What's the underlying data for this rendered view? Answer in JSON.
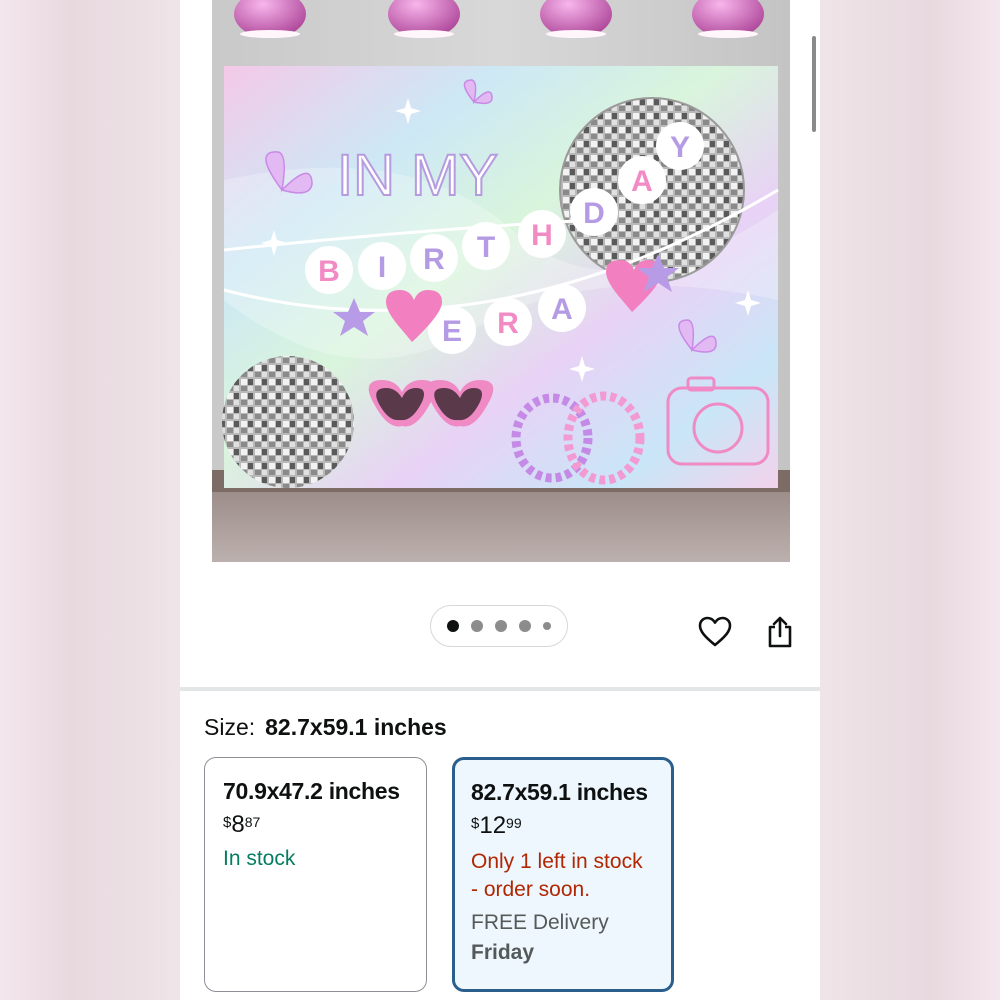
{
  "product_image": {
    "banner_line1": "IN MY",
    "banner_letters_birthday": [
      "B",
      "I",
      "R",
      "T",
      "H",
      "D",
      "A",
      "Y"
    ],
    "banner_letters_era": [
      "E",
      "R",
      "A"
    ]
  },
  "carousel": {
    "count": 5,
    "active": 1
  },
  "size": {
    "label": "Size:",
    "selected": "82.7x59.1 inches"
  },
  "options": [
    {
      "title": "70.9x47.2 inches",
      "price": {
        "symbol": "$",
        "whole": "8",
        "fraction": "87"
      },
      "stock": "In stock",
      "selected": false
    },
    {
      "title": "82.7x59.1 inches",
      "price": {
        "symbol": "$",
        "whole": "12",
        "fraction": "99"
      },
      "stock_line1": "Only 1 left in stock",
      "stock_line2": "- order soon.",
      "delivery": "FREE Delivery",
      "delivery_day": "Friday",
      "selected": true
    }
  ],
  "icons": {
    "wishlist": "heart-outline-icon",
    "share": "share-icon"
  },
  "colors": {
    "in_stock": "#067d62",
    "low_stock": "#b12704",
    "selected_border": "#2a5e8c",
    "selected_bg": "#edf7fd"
  }
}
